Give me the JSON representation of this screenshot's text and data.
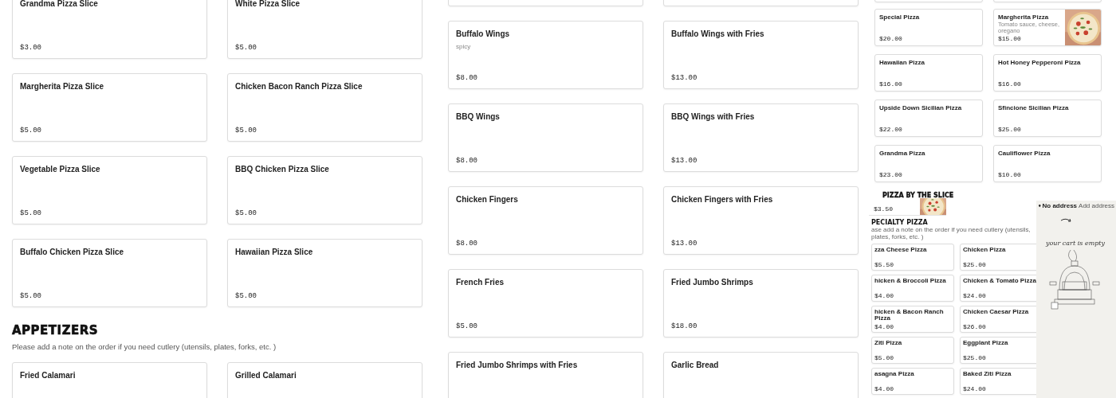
{
  "slices_panel": {
    "slices": [
      {
        "name": "Grandma Pizza Slice",
        "price": "$3.00"
      },
      {
        "name": "White Pizza Slice",
        "price": "$5.00"
      },
      {
        "name": "Margherita Pizza Slice",
        "price": "$5.00"
      },
      {
        "name": "Chicken Bacon Ranch Pizza Slice",
        "price": "$5.00"
      },
      {
        "name": "Vegetable Pizza Slice",
        "price": "$5.00"
      },
      {
        "name": "BBQ Chicken Pizza Slice",
        "price": "$5.00"
      },
      {
        "name": "Buffalo Chicken Pizza Slice",
        "price": "$5.00"
      },
      {
        "name": "Hawaiian Pizza Slice",
        "price": "$5.00"
      }
    ],
    "appetizers": {
      "title": "APPETIZERS",
      "note": "Please add a note on the order if you need cutlery (utensils, plates, forks, etc. )",
      "items": [
        {
          "name": "Fried Calamari"
        },
        {
          "name": "Grilled Calamari"
        }
      ]
    }
  },
  "wings_panel": {
    "items": [
      {
        "name": "Buffalo Wings",
        "description": "spicy",
        "price": "$8.00"
      },
      {
        "name": "Buffalo Wings with Fries",
        "price": "$13.00"
      },
      {
        "name": "BBQ Wings",
        "price": "$8.00"
      },
      {
        "name": "BBQ Wings with Fries",
        "price": "$13.00"
      },
      {
        "name": "Chicken Fingers",
        "price": "$8.00"
      },
      {
        "name": "Chicken Fingers with Fries",
        "price": "$13.00"
      },
      {
        "name": "French Fries",
        "price": "$5.00"
      },
      {
        "name": "Fried Jumbo Shrimps",
        "price": "$18.00"
      },
      {
        "name": "Fried Jumbo Shrimps with Fries"
      },
      {
        "name": "Garlic Bread"
      }
    ]
  },
  "specialty_preview": {
    "items": [
      {
        "kind": "plain",
        "name": "Special Pizza",
        "price": "$20.00"
      },
      {
        "name": "Margherita Pizza",
        "description": "Tomato sauce, cheese, oregano",
        "price": "$15.00"
      },
      {
        "kind": "plain",
        "name": "Hawaiian Pizza",
        "price": "$16.00"
      },
      {
        "kind": "plain",
        "name": "Hot Honey Pepperoni Pizza",
        "price": "$16.00"
      },
      {
        "kind": "plain",
        "name": "Upside Down Sicilian Pizza",
        "price": "$22.00"
      },
      {
        "kind": "plain",
        "name": "Sfincione Sicilian Pizza",
        "price": "$25.00"
      },
      {
        "kind": "plain",
        "name": "Grandma Pizza",
        "price": "$23.00"
      },
      {
        "kind": "plain",
        "name": "Cauliflower Pizza",
        "price": "$10.00"
      }
    ]
  },
  "slice_preview": {
    "heading": "PIZZA BY THE SLICE",
    "cut_card_price": "$3.50",
    "section_title": "PECIALTY PIZZA",
    "note": "ase add a note on the order if you need cutlery (utensils, plates, forks, etc. )",
    "items": [
      {
        "name": "zza Cheese Pizza",
        "price": "$5.50"
      },
      {
        "name": "Chicken Pizza",
        "price": "$25.00"
      },
      {
        "name": "hicken & Broccoli Pizza",
        "price": "$4.00"
      },
      {
        "name": "Chicken & Tomato Pizza",
        "price": "$24.00"
      },
      {
        "name": "hicken & Bacon Ranch Pizza",
        "price": "$4.00"
      },
      {
        "name": "Chicken Caesar Pizza",
        "price": "$26.00"
      },
      {
        "name": "Ziti Pizza",
        "price": "$5.00"
      },
      {
        "name": "Eggplant Pizza",
        "price": "$25.00"
      },
      {
        "name": "asagna Pizza",
        "price": "$4.00"
      },
      {
        "name": "Baked Ziti Pizza",
        "price": "$24.00"
      }
    ]
  },
  "cart_preview": {
    "address": "No address",
    "address_action": "Add address",
    "message": "your cart is empty"
  }
}
